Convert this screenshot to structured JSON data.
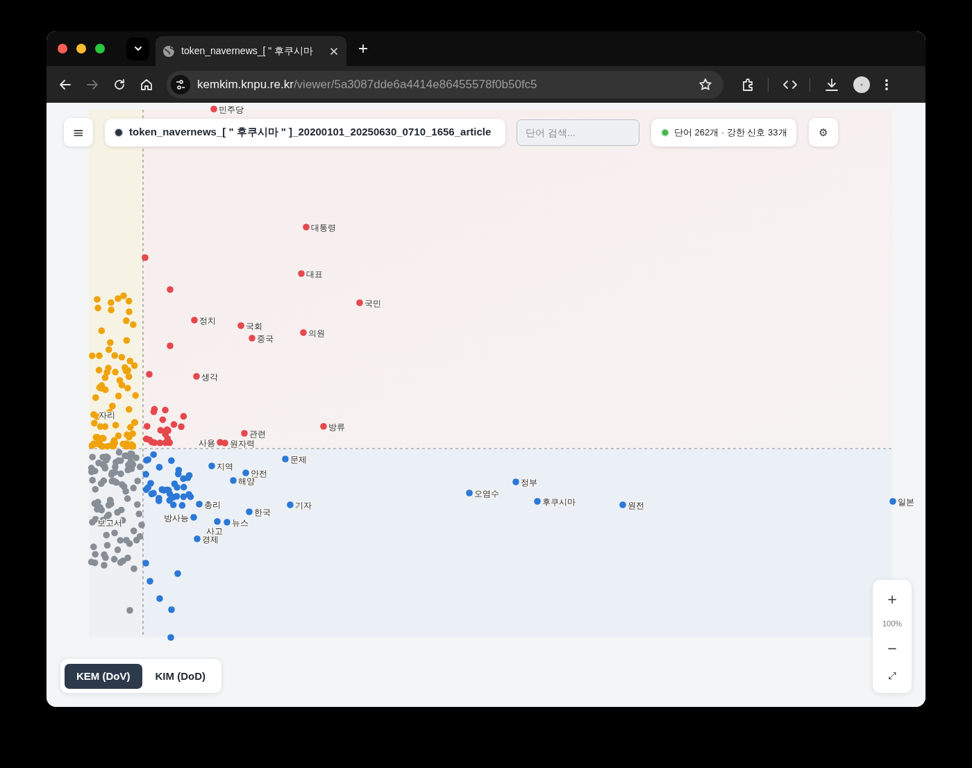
{
  "browser": {
    "tabs": [
      {
        "title": "token_navernews_[ \" 후쿠시마",
        "selected": true
      }
    ],
    "url_host": "kemkim.knpu.re.kr",
    "url_path": "/viewer/5a3087dde6a4414e86455578f0b50fc5",
    "forward_disabled": true
  },
  "toolbar": {
    "menu_glyph": "≡",
    "dataset": "token_navernews_[ \" 후쿠시마 \" ]_20200101_20250630_0710_1656_article",
    "search": {
      "placeholder": "단어 검색..."
    },
    "stats": "단어 262개 · 강한 신호 33개",
    "settings_glyph": "⚙"
  },
  "plot": {
    "labels": [
      {
        "text": "민주당",
        "color": "#e5484d"
      },
      {
        "text": "대통령",
        "color": "#e5484d"
      },
      {
        "text": "대표",
        "color": "#e5484d"
      },
      {
        "text": "국민",
        "color": "#e5484d"
      },
      {
        "text": "정치",
        "color": "#e5484d"
      },
      {
        "text": "국회",
        "color": "#e5484d"
      },
      {
        "text": "의원",
        "color": "#e5484d"
      },
      {
        "text": "중국",
        "color": "#e5484d"
      },
      {
        "text": "생각",
        "color": "#e5484d"
      },
      {
        "text": "자리",
        "color": "#efa30a"
      },
      {
        "text": "방류",
        "color": "#e5484d"
      },
      {
        "text": "관련",
        "color": "#e5484d"
      },
      {
        "text": "사용",
        "color": "#e5484d"
      },
      {
        "text": "원자력",
        "color": "#e5484d"
      },
      {
        "text": "문제",
        "color": "#2b78d6"
      },
      {
        "text": "지역",
        "color": "#2b78d6"
      },
      {
        "text": "안전",
        "color": "#2b78d6"
      },
      {
        "text": "해양",
        "color": "#2b78d6"
      },
      {
        "text": "정부",
        "color": "#2b78d6"
      },
      {
        "text": "오염수",
        "color": "#2b78d6"
      },
      {
        "text": "총리",
        "color": "#2b78d6"
      },
      {
        "text": "기자",
        "color": "#2b78d6"
      },
      {
        "text": "후쿠시마",
        "color": "#2b78d6"
      },
      {
        "text": "원전",
        "color": "#2b78d6"
      },
      {
        "text": "일본",
        "color": "#2b78d6"
      },
      {
        "text": "한국",
        "color": "#2b78d6"
      },
      {
        "text": "보고서",
        "color": "#888e96"
      },
      {
        "text": "방사능",
        "color": "#2b78d6"
      },
      {
        "text": "사고",
        "color": "#2b78d6"
      },
      {
        "text": "뉴스",
        "color": "#2b78d6"
      },
      {
        "text": "경제",
        "color": "#2b78d6"
      }
    ]
  },
  "zoom": {
    "zoom_in": "+",
    "zoom_text": "100%",
    "zoom_out": "−",
    "fit": "⤢"
  },
  "modes": [
    {
      "label": "KEM (DoV)",
      "selected": true
    },
    {
      "label": "KIM (DoD)",
      "selected": false
    }
  ]
}
